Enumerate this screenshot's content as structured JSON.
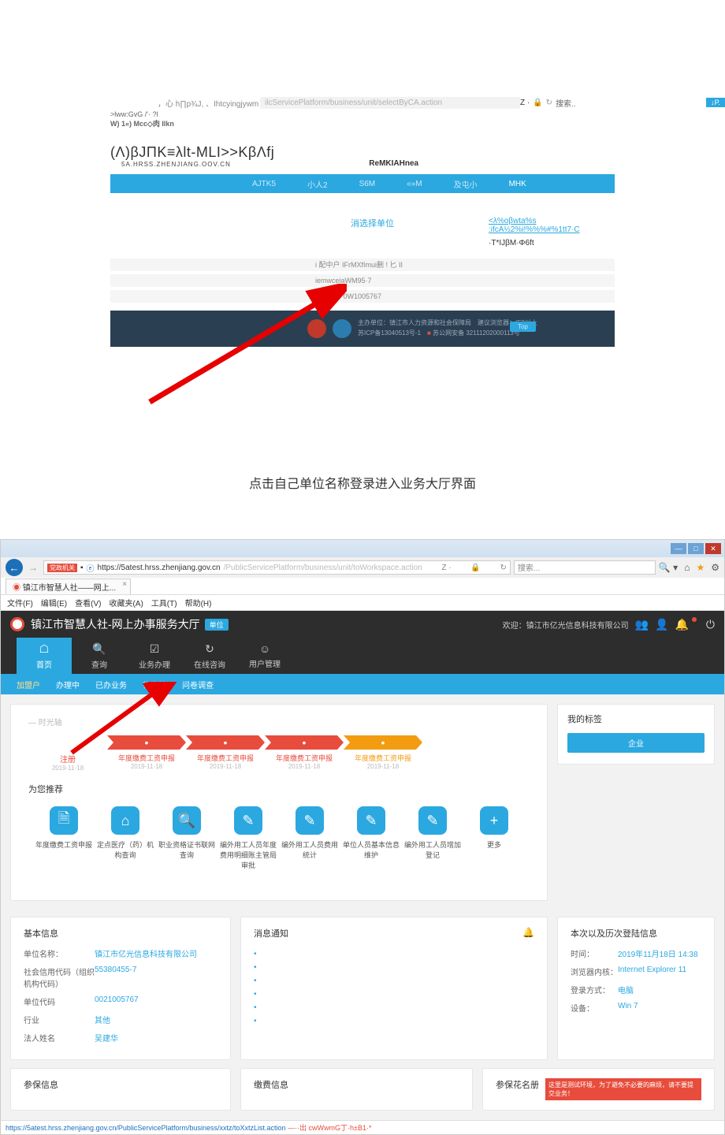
{
  "shot1": {
    "addr_left": "，心 h∏p¾J, 、Ihtcyingjywm",
    "addr_mid": "ilcServicePlatform/business/unit/selectByCA.action",
    "addr_search_prefix": "Z · ",
    "addr_search": "搜索..",
    "addr_star": "↓P.",
    "sub1": ">lww:GvG /'· ?l",
    "sub2": "W) 1«) Mcc◇肉 IIkn",
    "logo": "(Λ)βJΠK≡λlt-MLI>>KβΛfj",
    "logo_sub": "5A.HRSS.ZHENJIANG.OOV.CN",
    "login": "ReMKIAHnea",
    "nav": [
      "AJTK5",
      "小人2",
      "S6M",
      "«»M",
      "及屯小",
      "MHK"
    ],
    "mid_left": "消选择单位",
    "mid_r1": "<λ%oβwta%s :ifcA½2%i!%%%#%1tt7·C",
    "mid_r2": "·T*IJβM·Φ6ft",
    "line1": "i 配中户 IFrMXfImui删 ! 匕 II",
    "line2": "iemwceiaWM95·7",
    "line3": "(·GWft丨0W1005767",
    "foot1": "主办单位：镇江市人力资源和社会保障局　建议浏览器：IE9以上",
    "foot2": "苏ICP备13040513号-1　",
    "foot2b": "苏公网安备 32111202000113号",
    "tag": "Top"
  },
  "caption": "点击自己单位名称登录进入业务大厅界面",
  "shot2": {
    "url_badge": "党政机关",
    "url_main": "https://5atest.hrss.zhenjiang.gov.cn",
    "url_tail": "/PublicServicePlatform/business/unit/toWorkspace.action",
    "search_ph": "搜索...",
    "search_prefix": "Z · ",
    "tab": "镇江市智慧人社——网上...",
    "menu": [
      "文件(F)",
      "编辑(E)",
      "查看(V)",
      "收藏夹(A)",
      "工具(T)",
      "帮助(H)"
    ],
    "title": "镇江市智慧人社-网上办事服务大厅",
    "title_tag": "单位",
    "welcome": "欢迎：镇江市亿光信息科技有限公司",
    "topnav": [
      {
        "ic": "☖",
        "t": "首页"
      },
      {
        "ic": "🔍",
        "t": "查询"
      },
      {
        "ic": "☑",
        "t": "业务办理"
      },
      {
        "ic": "↻",
        "t": "在线咨询"
      },
      {
        "ic": "☺",
        "t": "用户管理"
      }
    ],
    "subnav": [
      "加盟户",
      "办理中",
      "已办业务",
      "待审核",
      "问卷调查"
    ],
    "tl_label": "— 时光轴",
    "steps": [
      {
        "l": "注册",
        "d": "2019-11-18"
      },
      {
        "l": "年度缴费工资申报",
        "d": "2019-11-18"
      },
      {
        "l": "年度缴费工资申报",
        "d": "2019-11-18"
      },
      {
        "l": "年度缴费工资申报",
        "d": "2019-11-18"
      },
      {
        "l": "年度缴费工资申报",
        "d": "2019-11-18"
      }
    ],
    "rec_title": "为您推荐",
    "services": [
      {
        "t": "年度缴费工资申报"
      },
      {
        "t": "定点医疗（药）机构查询"
      },
      {
        "t": "职业资格证书联网查询"
      },
      {
        "t": "编外用工人员年度费用明细账主管局审批"
      },
      {
        "t": "编外用工人员费用统计"
      },
      {
        "t": "单位人员基本信息维护"
      },
      {
        "t": "编外用工人员增加登记"
      },
      {
        "t": "更多"
      }
    ],
    "tags_title": "我的标签",
    "tags_btn": "企业",
    "basic_title": "基本信息",
    "basic": [
      {
        "k": "单位名称：",
        "v": "镇江市亿光信息科技有限公司"
      },
      {
        "k": "社会信用代码（组织机构代码）",
        "v": "55380455-7"
      },
      {
        "k": "单位代码",
        "v": "0021005767"
      },
      {
        "k": "行业",
        "v": "其他"
      },
      {
        "k": "法人姓名",
        "v": "吴建华"
      }
    ],
    "notice_title": "消息通知",
    "login_title": "本次以及历次登陆信息",
    "login": [
      {
        "k": "时间：",
        "v": "2019年11月18日 14:38"
      },
      {
        "k": "浏览器内核：",
        "v": "Internet Explorer 11"
      },
      {
        "k": "登录方式：",
        "v": "电脑"
      },
      {
        "k": "设备：",
        "v": "Win 7"
      }
    ],
    "p4a": "参保信息",
    "p4b": "缴费信息",
    "p4c": "参保花名册",
    "p4warn": "这里是测试环境，为了避免不必要的麻烦，请不要提交业务！",
    "status": "https://5atest.hrss.zhenjiang.gov.cn/PublicServicePlatform/business/xxtz/toXxtzList.action",
    "status2": "—··出 cwWwmG丁·h±B1·*"
  }
}
